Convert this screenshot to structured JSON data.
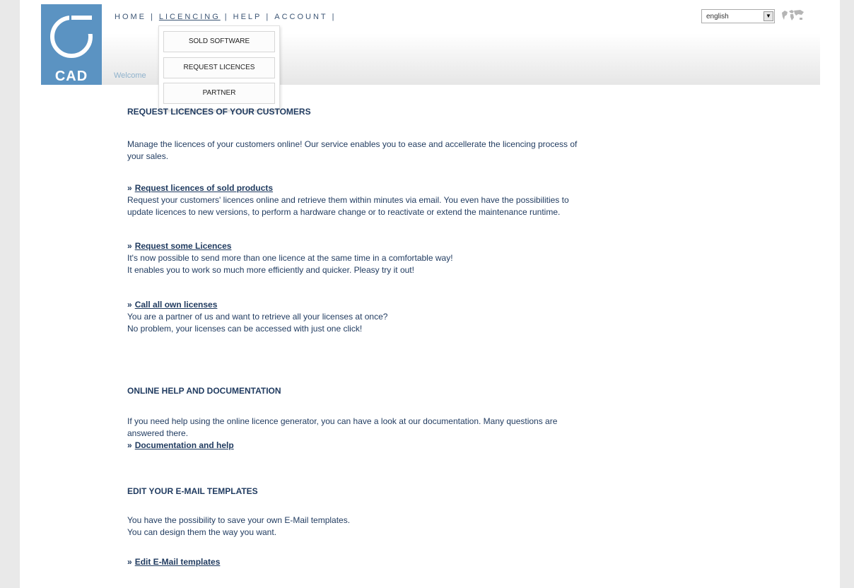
{
  "header": {
    "logo_text": "CAD",
    "welcome": "Welcome",
    "nav": [
      {
        "label": "HOME"
      },
      {
        "label": "LICENCING"
      },
      {
        "label": "HELP"
      },
      {
        "label": "ACCOUNT"
      }
    ],
    "separator": "|",
    "dropdown": [
      "SOLD SOFTWARE",
      "REQUEST LICENCES",
      "PARTNER"
    ],
    "language": "english"
  },
  "sections": {
    "request": {
      "title": "REQUEST LICENCES OF YOUR CUSTOMERS",
      "intro_1": "Manage the licences of your customers online! Our service enables you to ease and accellerate the licencing process of",
      "intro_2": "your sales.",
      "link1": "Request licences of sold products",
      "link1_desc_1": "Request your customers' licences online and retrieve them within minutes via email. You even have the possibilities to",
      "link1_desc_2": "update licences to new versions, to perform a hardware change or to reactivate or extend the maintenance runtime.",
      "link2": "Request some Licences",
      "link2_desc_1": "It's now possible to send more than one licence at the same time in a comfortable way!",
      "link2_desc_2": "It enables you to work so much more efficiently and quicker. Pleasy try it out!",
      "link3": "Call all own licenses",
      "link3_desc_1": "You are a partner of us and want to retrieve all your licenses at once?",
      "link3_desc_2": "No problem, your licenses can be accessed with just one click!"
    },
    "help": {
      "title": "ONLINE HELP AND DOCUMENTATION",
      "desc_1": "If you need help using the online licence generator, you can have a look at our documentation. Many questions are",
      "desc_2": "answered there.",
      "link": "Documentation and help"
    },
    "templates": {
      "title": "EDIT YOUR E-MAIL TEMPLATES",
      "desc_1": "You have the possibility to save your own E-Mail templates.",
      "desc_2": "You can design them the way you want.",
      "link": "Edit E-Mail templates"
    }
  },
  "symbols": {
    "raquo": "»",
    "dropdown_arrow": "▼"
  }
}
